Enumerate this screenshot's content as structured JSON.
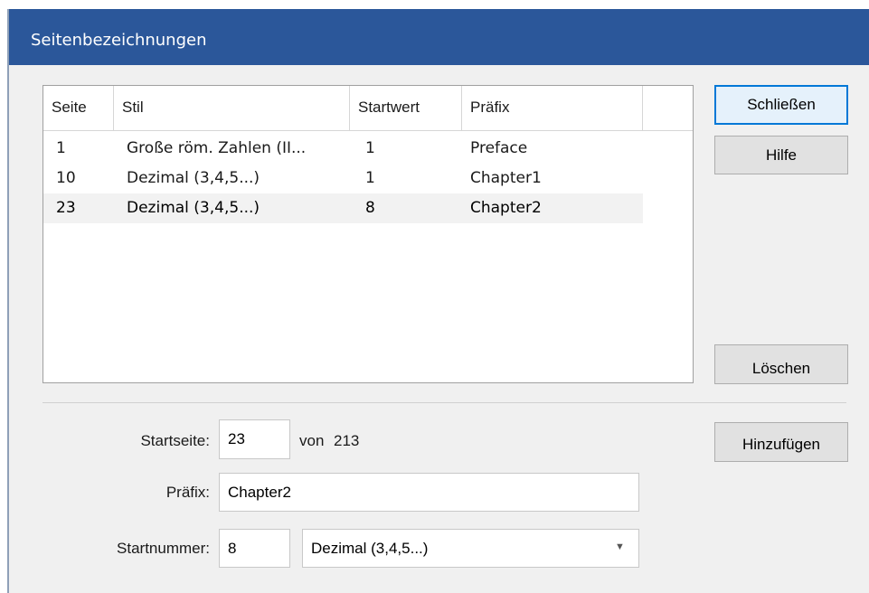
{
  "dialog": {
    "title": "Seitenbezeichnungen"
  },
  "list": {
    "columns": [
      "Seite",
      "Stil",
      "Startwert",
      "Präfix"
    ],
    "rows": [
      {
        "page": "1",
        "style": "Große röm. Zahlen (II...",
        "start": "1",
        "prefix": "Preface",
        "selected": false
      },
      {
        "page": "10",
        "style": "Dezimal (3,4,5...)",
        "start": "1",
        "prefix": "Chapter1",
        "selected": false
      },
      {
        "page": "23",
        "style": "Dezimal (3,4,5...)",
        "start": "8",
        "prefix": "Chapter2",
        "selected": true
      }
    ]
  },
  "buttons": {
    "close": "Schließen",
    "help": "Hilfe",
    "delete": "Löschen",
    "add": "Hinzufügen"
  },
  "form": {
    "start_page_label": "Startseite:",
    "start_page_value": "23",
    "of_label": "von",
    "total_pages": "213",
    "prefix_label": "Präfix:",
    "prefix_value": "Chapter2",
    "start_number_label": "Startnummer:",
    "start_number_value": "8",
    "style_value": "Dezimal (3,4,5...)"
  },
  "colors": {
    "titlebar": "#2b579a",
    "accent": "#0078d7"
  },
  "icons": {
    "combo_arrow": "chevron-down-icon"
  }
}
